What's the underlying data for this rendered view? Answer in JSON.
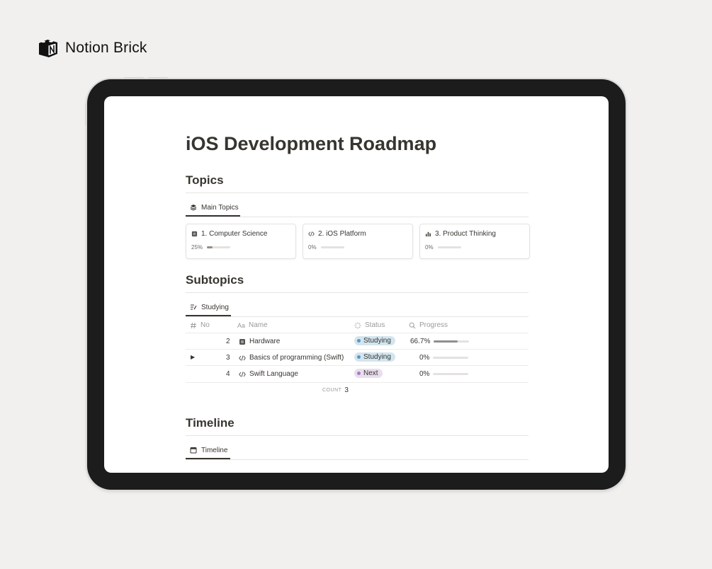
{
  "brand": {
    "name": "Notion Brick",
    "logo_icon": "notion-brick-cube-icon"
  },
  "page": {
    "title": "iOS Development Roadmap"
  },
  "topics": {
    "heading": "Topics",
    "view_tab": {
      "label": "Main Topics",
      "icon": "stack-icon"
    },
    "cards": [
      {
        "title": "1. Computer Science",
        "icon": "chip-icon",
        "progress_text": "25%",
        "progress": 0.25
      },
      {
        "title": "2. iOS Platform",
        "icon": "code-icon",
        "progress_text": "0%",
        "progress": 0
      },
      {
        "title": "3. Product Thinking",
        "icon": "bar-chart-icon",
        "progress_text": "0%",
        "progress": 0
      }
    ]
  },
  "subtopics": {
    "heading": "Subtopics",
    "view_tab": {
      "label": "Studying",
      "icon": "list-edit-icon"
    },
    "columns": [
      {
        "label": "No",
        "icon": "hash-icon"
      },
      {
        "label": "Name",
        "icon": "text-aa-icon"
      },
      {
        "label": "Status",
        "icon": "status-spinner-icon"
      },
      {
        "label": "Progress",
        "icon": "search-icon"
      }
    ],
    "rows": [
      {
        "no": "2",
        "name": "Hardware",
        "icon": "chip-icon",
        "status": "Studying",
        "progress_text": "66.7%",
        "progress": 0.667,
        "toggle": false
      },
      {
        "no": "3",
        "name": "Basics of programming (Swift)",
        "icon": "code-icon",
        "status": "Studying",
        "progress_text": "0%",
        "progress": 0,
        "toggle": true
      },
      {
        "no": "4",
        "name": "Swift Language",
        "icon": "code-icon",
        "status": "Next",
        "progress_text": "0%",
        "progress": 0,
        "toggle": false
      }
    ],
    "count_label": "COUNT",
    "count_value": "3"
  },
  "timeline": {
    "heading": "Timeline",
    "view_tab": {
      "label": "Timeline",
      "icon": "calendar-icon"
    }
  },
  "colors": {
    "studying_bg": "#d3e5ef",
    "studying_dot": "#5b97bd",
    "next_bg": "#e8deee",
    "next_dot": "#a77bc2"
  }
}
